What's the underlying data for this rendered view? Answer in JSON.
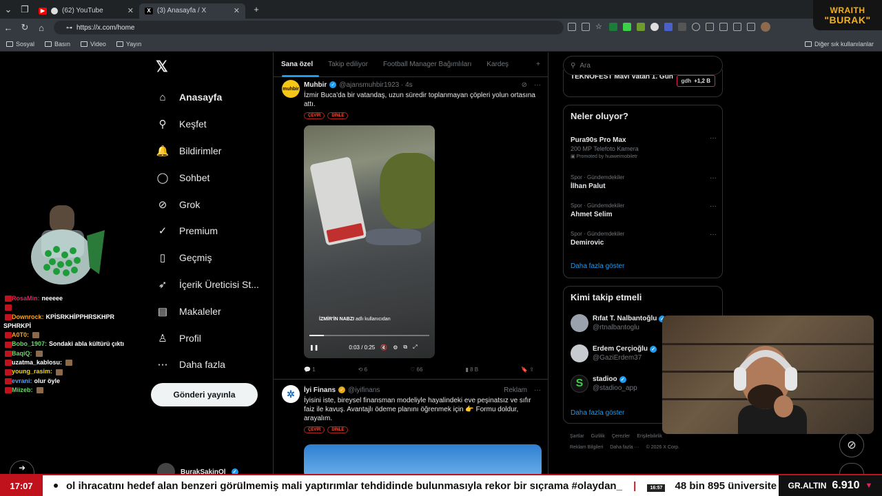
{
  "browser": {
    "tabs": [
      {
        "label": "(62) YouTube",
        "icon": "youtube-icon",
        "color": "#ff0000"
      },
      {
        "label": "(3) Anasayfa / X",
        "icon": "x-icon",
        "color": "#000000"
      }
    ],
    "new_tab": "+",
    "url": "https://x.com/home",
    "bookmarks": [
      "Sosyal",
      "Basın",
      "Video",
      "Yayın"
    ],
    "other_bookmarks": "Diğer sık kullanılanlar"
  },
  "overlay_badge": {
    "line1": "WRAITH",
    "line2": "\"BURAK\""
  },
  "x": {
    "nav": [
      {
        "label": "Anasayfa",
        "icon": "home-icon",
        "glyph": "⌂"
      },
      {
        "label": "Keşfet",
        "icon": "search-icon",
        "glyph": "⚲"
      },
      {
        "label": "Bildirimler",
        "icon": "bell-icon",
        "glyph": "🔔",
        "badge": "3"
      },
      {
        "label": "Sohbet",
        "icon": "chat-icon",
        "glyph": "◯"
      },
      {
        "label": "Grok",
        "icon": "grok-icon",
        "glyph": "⊘"
      },
      {
        "label": "Premium",
        "icon": "premium-icon",
        "glyph": "✓"
      },
      {
        "label": "Geçmiş",
        "icon": "bookmark-icon",
        "glyph": "▯"
      },
      {
        "label": "İçerik Üreticisi St...",
        "icon": "rocket-icon",
        "glyph": "➶"
      },
      {
        "label": "Makaleler",
        "icon": "articles-icon",
        "glyph": "▤"
      },
      {
        "label": "Profil",
        "icon": "profile-icon",
        "glyph": "♙"
      },
      {
        "label": "Daha fazla",
        "icon": "more-icon",
        "glyph": "⋯"
      }
    ],
    "post_button": "Gönderi yayınla",
    "account_name": "BurakSakinOl",
    "feed_tabs": [
      "Sana özel",
      "Takip ediliyor",
      "Football Manager Bağımlıları",
      "Kardeş"
    ],
    "feed_tab_add": "+",
    "tweet1": {
      "avatar_text": "muhbir",
      "name": "Muhbir",
      "handle": "@ajansmuhbir1923 · 4s",
      "text": "İzmir Buca'da bir vatandaş, uzun süredir toplanmayan çöpleri yolun ortasına attı.",
      "chips": [
        "ÇEVİR",
        "DİNLE"
      ],
      "video_tag_bold": "İZMİR'İN NABZI",
      "video_tag_rest": " adlı kullanıcıdan",
      "video_time": "0:03 / 0:25",
      "video_progress": 0.12,
      "replies": "1",
      "reposts": "6",
      "likes": "66",
      "views": "8 B"
    },
    "tweet2": {
      "name": "İyi Finans",
      "handle": "@iyifinans",
      "label": "Reklam",
      "text": "İyisini iste, bireysel finansman modeliyle hayalindeki eve peşinatsız ve sıfır faiz ile kavuş. Avantajlı ödeme planını öğrenmek için 👉 Formu doldur, arayalım.",
      "chips": [
        "ÇEVİR",
        "DİNLE"
      ]
    },
    "search_placeholder": "Ara",
    "teknofest": {
      "title": "TEKNOFEST Mavi Vatan 1. Gün",
      "pill": "+1,2 B",
      "pill_prefix": "gdh"
    },
    "happening": {
      "title": "Neler oluyor?",
      "trends": [
        {
          "meta": "",
          "name": "Pura90s Pro Max",
          "sub": "200 MP Telefoto Kamera",
          "promoted": "Promoted by huaweimobiletr"
        },
        {
          "meta": "Spor · Gündemdekiler",
          "name": "İlhan Palut",
          "sub": "",
          "promoted": ""
        },
        {
          "meta": "Spor · Gündemdekiler",
          "name": "Ahmet Selim",
          "sub": "",
          "promoted": ""
        },
        {
          "meta": "Spor · Gündemdekiler",
          "name": "Demirovic",
          "sub": "",
          "promoted": ""
        }
      ],
      "more": "Daha fazla göster"
    },
    "who_to_follow": {
      "title": "Kimi takip etmeli",
      "users": [
        {
          "name": "Rıfat T. Nalbantoğlu",
          "handle": "@rtnalbantoglu"
        },
        {
          "name": "Erdem Çerçioğlu",
          "handle": "@GaziErdem37"
        },
        {
          "name": "stadioo",
          "handle": "@stadioo_app"
        }
      ],
      "more": "Daha fazla göster"
    },
    "footer": [
      "Şartlar",
      "Gizlilik",
      "Çerezler",
      "Erişilebilirlik",
      "Reklam Bilgileri",
      "Daha fazla ···",
      "© 2026 X Corp."
    ]
  },
  "chat": [
    {
      "user": "RosaMin:",
      "msg": "neeeee",
      "color": "#e0245e"
    },
    {
      "user": "",
      "msg": "",
      "color": "#e0245e"
    },
    {
      "user": "Downrock:",
      "msg": "KPİSRKHİPPHRSKHPR SPHRKPİ",
      "color": "#f5a623"
    },
    {
      "user": "A0T0:",
      "msg": "",
      "color": "#f5a623"
    },
    {
      "user": "Bobo_1907:",
      "msg": "Sondaki abla kültürü çıktı",
      "color": "#6bd66b"
    },
    {
      "user": "BaqiQ:",
      "msg": "",
      "color": "#6bd66b"
    },
    {
      "user": "uzatma_kablosu:",
      "msg": "",
      "color": "#ffffff"
    },
    {
      "user": "young_rasim:",
      "msg": "",
      "color": "#f5d90a"
    },
    {
      "user": "evrani:",
      "msg": "olur öyle",
      "color": "#4aa3ff"
    },
    {
      "user": "Miizeb:",
      "msg": "",
      "color": "#6bd66b"
    }
  ],
  "ticker": {
    "time": "17:07",
    "text": "ol ihracatını hedef alan benzeri görülmemiş mali yaptırımlar tehdidinde bulunmasıyla rekor bir sıçrama #olaydan_",
    "small_time": "16:57",
    "text2": "48 bin 895 üniversite mezunu, bu",
    "gold_label": "GR.ALTIN",
    "gold_value": "6.910",
    "gold_arrow": "▼"
  }
}
